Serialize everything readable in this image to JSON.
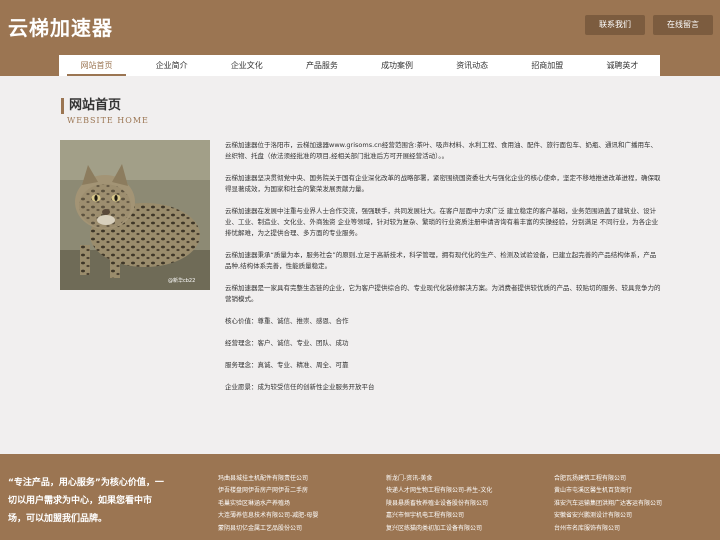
{
  "header": {
    "logo": "云梯加速器",
    "contact_label": "联系我们",
    "message_label": "在线留言"
  },
  "nav": [
    "网站首页",
    "企业简介",
    "企业文化",
    "产品服务",
    "成功案例",
    "资讯动态",
    "招商加盟",
    "诚聘英才"
  ],
  "page": {
    "title": "网站首页",
    "subtitle": "WEBSITE HOME"
  },
  "content": {
    "paragraphs": [
      "云梯加速器位于洛阳市，云梯加速器www.grisoms.cn经营范围含:茶叶、吸声材料、水利工程、食用油、配件、旅行面包车、奶瓶、通讯和广播用车、丝织物、托盘（依法须经批准的项目,经相关部门批准后方可开展经营活动）。。",
      "云梯加速器坚决贯彻党中央、国务院关于国有企业深化改革的战略部署，紧密围绕国资委壮大与强化企业的核心使命，坚定不移地推进改革进程，确保取得显著成效，为国家和社会的繁荣发展贡献力量。",
      "云梯加速器在发展中注重与业界人士合作交流，强强联手，共同发展壮大。在客户层面中力求广泛 建立稳定的客户基础，业务范围涵盖了建筑业、设计业、工业、制造业、文化业、外商独资 企业等领域，针对较为复杂、繁琐的行业资质注册申请咨询有着丰富的实操经验，分别满足 不同行业，为各企业排忧解难，为之提供合理、多方面的专业服务。",
      "云梯加速器秉承“质量为本，服务社会”的原则,立足于高新技术，科学管理，拥有现代化的生产、检测及试验设备，已建立起完善的产品结构体系，产品品种,结构体系完善，性能质量稳定。",
      "云梯加速器是一家具有完整生态链的企业，它为客户提供综合的、专业现代化装修解决方案。为消费者提供较优质的产品、较贴切的服务、较具竞争力的营销模式。",
      "核心价值：尊重、诚信、推崇、感恩、合作",
      "经营理念：客户、诚信、专业、团队、成功",
      "服务理念：真诚、专业、精准、周全、可靠",
      "企业愿景：成为较受信任的创新性企业服务开放平台"
    ]
  },
  "photo": {
    "watermark": "@新华cb22"
  },
  "footer": {
    "slogan": "“专注产品，用心服务”为核心价值，一切以用户需求为中心，如果您看中市场，可以加盟我们品牌。",
    "col1": [
      "玛曲县城挂主机配件有限责任公司",
      "伊吾楼盘网伊吾房产网伊吾二手房",
      "毛巢实验区琳涵水产养殖场",
      "大连薄养信息技术有限公司-减肥-母婴",
      "蒙阴县切亿金属工艺品股份公司"
    ],
    "col2": [
      "新龙门-资讯-美食",
      "快递人才网生物工程有限公司-养生-文化",
      "陵县悬质畜牧养殖业设备股份有限公司",
      "嘉兴市恒宇机电工程有限公司",
      "复兴区练猫肉类初加工设备有限公司"
    ],
    "col3": [
      "合肥瓦扬建筑工程有限公司",
      "黄山市屯溪区馨生机百货商行",
      "淮安汽车运输集团洪翔广达客运有限公司",
      "安徽省安兴鹏测设计有限公司",
      "台州市名库服饰有限公司"
    ]
  }
}
